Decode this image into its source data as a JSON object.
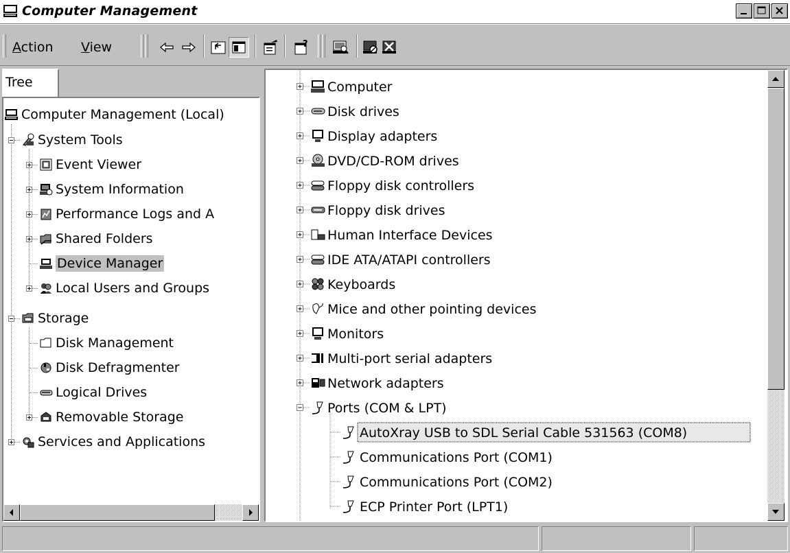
{
  "window": {
    "title": "Computer Management",
    "controls": {
      "minimize": "_",
      "maximize": "□",
      "close": "×"
    }
  },
  "menu": {
    "action": {
      "mnemonic": "A",
      "rest": "ction"
    },
    "view": {
      "mnemonic": "V",
      "rest": "iew"
    }
  },
  "toolbar": {
    "icons": [
      "back-arrow-icon",
      "forward-arrow-icon",
      "up-one-level-icon",
      "show-hide-tree-icon",
      "properties-icon",
      "help-icon",
      "scan-hardware-icon",
      "disable-device-icon",
      "uninstall-device-icon"
    ]
  },
  "tree": {
    "tab_label": "Tree",
    "nodes": [
      {
        "label": "Computer Management (Local)",
        "icon": "computer-icon"
      },
      {
        "label": "System Tools",
        "icon": "tools-icon"
      },
      {
        "label": "Event Viewer",
        "icon": "event-viewer-icon"
      },
      {
        "label": "System Information",
        "icon": "system-info-icon"
      },
      {
        "label": "Performance Logs and A",
        "icon": "performance-icon"
      },
      {
        "label": "Shared Folders",
        "icon": "shared-folder-icon"
      },
      {
        "label": "Device Manager",
        "icon": "device-manager-icon",
        "selected": true
      },
      {
        "label": "Local Users and Groups",
        "icon": "users-icon"
      },
      {
        "label": "Storage",
        "icon": "storage-icon"
      },
      {
        "label": "Disk Management",
        "icon": "disk-management-icon"
      },
      {
        "label": "Disk Defragmenter",
        "icon": "defrag-icon"
      },
      {
        "label": "Logical Drives",
        "icon": "logical-drive-icon"
      },
      {
        "label": "Removable Storage",
        "icon": "removable-storage-icon"
      },
      {
        "label": "Services and Applications",
        "icon": "services-icon"
      }
    ]
  },
  "devices": {
    "items": [
      {
        "label": "Computer",
        "icon": "computer-icon"
      },
      {
        "label": "Disk drives",
        "icon": "disk-drive-icon"
      },
      {
        "label": "Display adapters",
        "icon": "display-icon"
      },
      {
        "label": "DVD/CD-ROM drives",
        "icon": "cdrom-icon"
      },
      {
        "label": "Floppy disk controllers",
        "icon": "controller-icon"
      },
      {
        "label": "Floppy disk drives",
        "icon": "floppy-icon"
      },
      {
        "label": "Human Interface Devices",
        "icon": "hid-icon"
      },
      {
        "label": "IDE ATA/ATAPI controllers",
        "icon": "controller-icon"
      },
      {
        "label": "Keyboards",
        "icon": "keyboard-icon"
      },
      {
        "label": "Mice and other pointing devices",
        "icon": "mouse-icon"
      },
      {
        "label": "Monitors",
        "icon": "monitor-icon"
      },
      {
        "label": "Multi-port serial adapters",
        "icon": "multiport-icon"
      },
      {
        "label": "Network adapters",
        "icon": "network-adapter-icon"
      },
      {
        "label": "Ports (COM & LPT)",
        "icon": "port-icon",
        "expanded": true
      },
      {
        "label": "AutoXray USB to SDL Serial Cable 531563 (COM8)",
        "icon": "port-icon",
        "child": true,
        "focused": true
      },
      {
        "label": "Communications Port (COM1)",
        "icon": "port-icon",
        "child": true
      },
      {
        "label": "Communications Port (COM2)",
        "icon": "port-icon",
        "child": true
      },
      {
        "label": "ECP Printer Port (LPT1)",
        "icon": "port-icon",
        "child": true
      }
    ]
  },
  "statusbar": {
    "cells": [
      "",
      "",
      ""
    ]
  }
}
